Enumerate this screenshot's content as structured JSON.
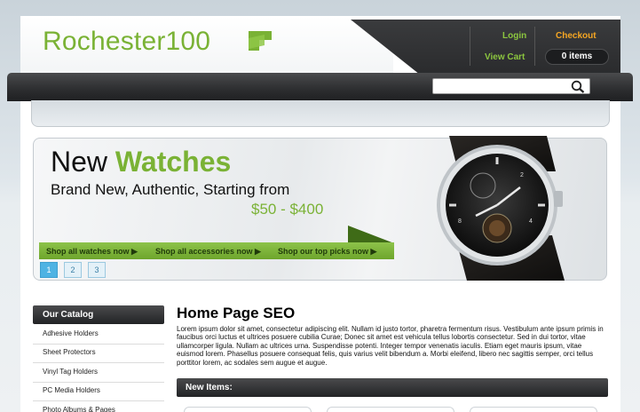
{
  "header": {
    "logo_text": "Rochester100",
    "links": {
      "login": "Login",
      "checkout": "Checkout",
      "view_cart": "View Cart"
    },
    "cart_count": "0 items"
  },
  "search": {
    "placeholder": ""
  },
  "banner": {
    "title_part1": "New ",
    "title_part2": "Watches",
    "subtitle": "Brand New, Authentic, Starting from",
    "price": "$50 - $400",
    "links": [
      "Shop all watches now ▶",
      "Shop all accessories now ▶",
      "Shop our top picks now ▶"
    ],
    "pages": [
      "1",
      "2",
      "3"
    ],
    "active_page": "1"
  },
  "sidebar": {
    "title": "Our Catalog",
    "items": [
      "Adhesive Holders",
      "Sheet Protectors",
      "Vinyl Tag Holders",
      "PC Media Holders",
      "Photo Albums & Pages"
    ]
  },
  "main": {
    "title": "Home Page SEO",
    "body": "Lorem ipsum dolor sit amet, consectetur adipiscing elit. Nullam id justo tortor, pharetra fermentum risus. Vestibulum ante ipsum primis in faucibus orci luctus et ultrices posuere cubilia Curae; Donec sit amet est vehicula tellus lobortis consectetur. Sed in dui tortor, vitae ullamcorper ligula. Nullam ac ultrices urna. Suspendisse potenti. Integer tempor venenatis iaculis. Etiam eget mauris ipsum, vitae euismod lorem. Phasellus posuere consequat felis, quis varius velit bibendum a. Morbi eleifend, libero nec sagittis semper, orci tellus porttitor lorem, ac sodales sem augue et augue.",
    "new_items_title": "New Items:"
  },
  "colors": {
    "brand_green": "#7ab235",
    "checkout_orange": "#f5a623",
    "dark_bar": "#2c2d2f",
    "pager_active": "#4fb3e3"
  }
}
